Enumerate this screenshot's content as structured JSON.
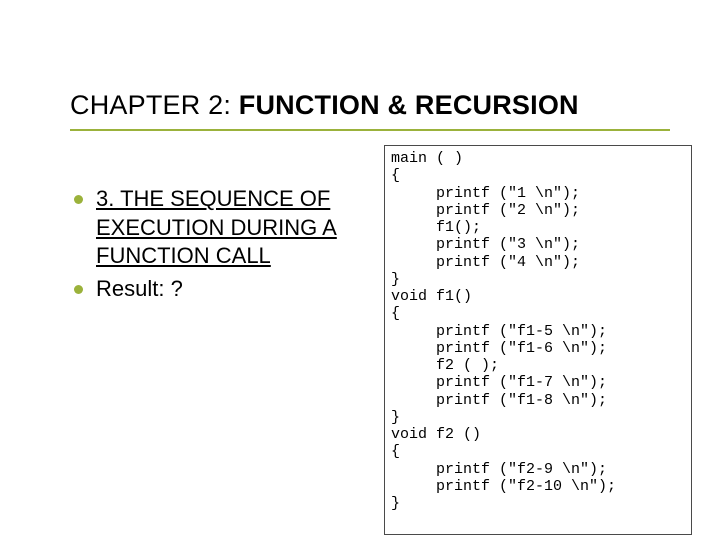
{
  "title_plain": "CHAPTER 2: ",
  "title_bold": "FUNCTION & RECURSION",
  "bullets": [
    {
      "text": "3.   THE SEQUENCE OF EXECUTION DURING A FUNCTION CALL",
      "underline": true
    },
    {
      "text": "Result: ?",
      "underline": false
    }
  ],
  "code": "main ( )\n{\n     printf (\"1 \\n\");\n     printf (\"2 \\n\");\n     f1();\n     printf (\"3 \\n\");\n     printf (\"4 \\n\");\n}\nvoid f1()\n{\n     printf (\"f1-5 \\n\");\n     printf (\"f1-6 \\n\");\n     f2 ( );\n     printf (\"f1-7 \\n\");\n     printf (\"f1-8 \\n\");\n}\nvoid f2 ()\n{\n     printf (\"f2-9 \\n\");\n     printf (\"f2-10 \\n\");\n}"
}
